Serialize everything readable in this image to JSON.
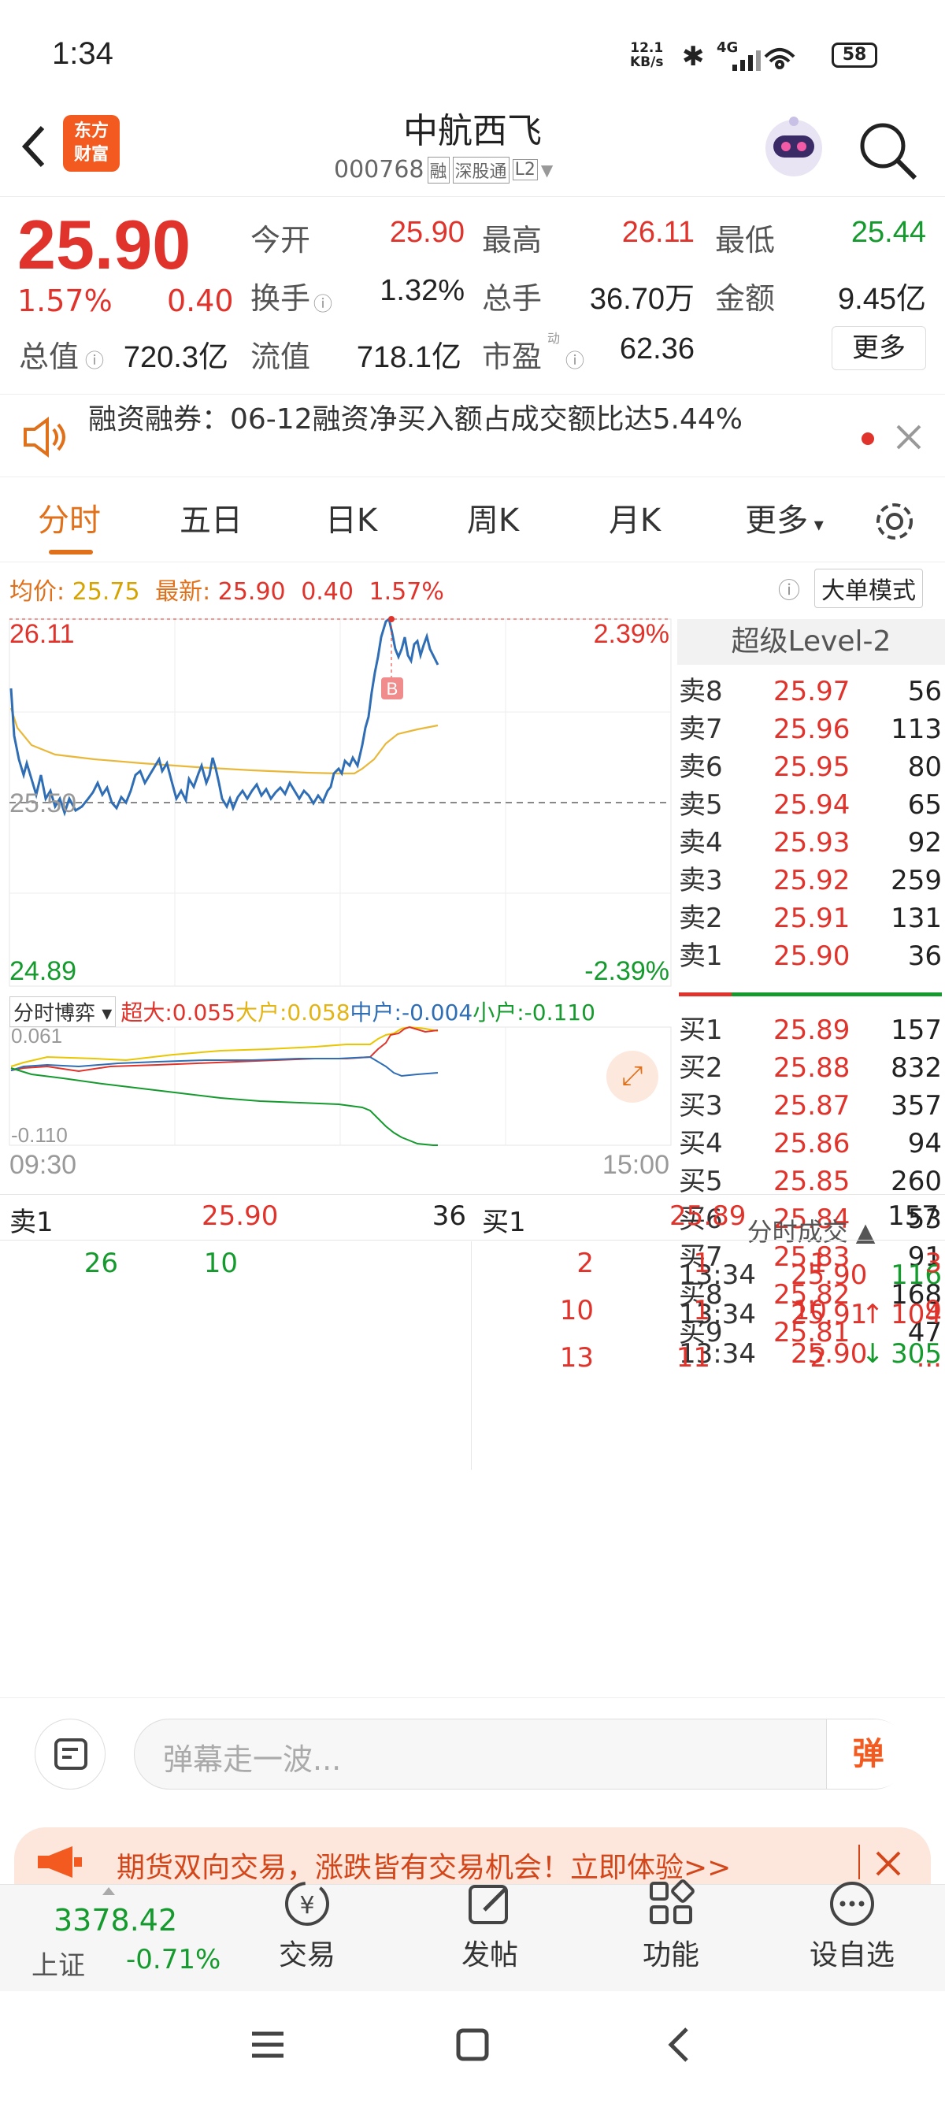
{
  "status": {
    "time": "1:34",
    "speed_num": "12.1",
    "speed_unit": "KB/s",
    "net": "4G",
    "battery": "58"
  },
  "header": {
    "logo_line1": "东方",
    "logo_line2": "财富",
    "stock_name": "中航西飞",
    "code": "000768",
    "tag_rong": "融",
    "tag_sgt": "深股通",
    "tag_l2": "L2"
  },
  "quote": {
    "price": "25.90",
    "change_pct": "1.57%",
    "change_amt": "0.40",
    "fields": [
      {
        "label": "今开",
        "value": "25.90",
        "color": "red"
      },
      {
        "label": "最高",
        "value": "26.11",
        "color": "red"
      },
      {
        "label": "最低",
        "value": "25.44",
        "color": "green"
      },
      {
        "label": "换手",
        "value": "1.32%",
        "color": "black"
      },
      {
        "label": "总手",
        "value": "36.70万",
        "color": "black"
      },
      {
        "label": "金额",
        "value": "9.45亿",
        "color": "black"
      },
      {
        "label": "总值",
        "value": "720.3亿",
        "color": "black"
      },
      {
        "label": "流值",
        "value": "718.1亿",
        "color": "black"
      },
      {
        "label": "市盈",
        "value": "62.36",
        "color": "black"
      }
    ],
    "more": "更多",
    "dyn": "动"
  },
  "news": {
    "text": "融资融券：06-12融资净买入额占成交额比达5.44%"
  },
  "tabs": [
    "分时",
    "五日",
    "日K",
    "周K",
    "月K",
    "更多"
  ],
  "info": {
    "avg_label": "均价:",
    "avg": "25.75",
    "last_label": "最新:",
    "last": "25.90",
    "chg": "0.40",
    "pct": "1.57%",
    "mode": "大单模式"
  },
  "chart_labels": {
    "high": "26.11",
    "high_pct": "2.39%",
    "mid": "25.50",
    "low": "24.89",
    "low_pct": "-2.39%",
    "marker": "B",
    "t_start": "09:30",
    "t_end": "15:00"
  },
  "flow": {
    "selector": "分时博弈",
    "items": [
      {
        "label": "超大:0.055",
        "color": "#e0332b"
      },
      {
        "label": "大户:0.058",
        "color": "#e3b415"
      },
      {
        "label": "中户:-0.004",
        "color": "#2f6db5"
      },
      {
        "label": "小户:-0.110",
        "color": "#159a2e"
      }
    ],
    "ymax": "0.061",
    "ymin": "-0.110"
  },
  "level2": {
    "title": "超级Level-2",
    "sells": [
      {
        "l": "卖8",
        "p": "25.97",
        "v": "56"
      },
      {
        "l": "卖7",
        "p": "25.96",
        "v": "113"
      },
      {
        "l": "卖6",
        "p": "25.95",
        "v": "80"
      },
      {
        "l": "卖5",
        "p": "25.94",
        "v": "65"
      },
      {
        "l": "卖4",
        "p": "25.93",
        "v": "92"
      },
      {
        "l": "卖3",
        "p": "25.92",
        "v": "259"
      },
      {
        "l": "卖2",
        "p": "25.91",
        "v": "131"
      },
      {
        "l": "卖1",
        "p": "25.90",
        "v": "36"
      }
    ],
    "buys": [
      {
        "l": "买1",
        "p": "25.89",
        "v": "157"
      },
      {
        "l": "买2",
        "p": "25.88",
        "v": "832"
      },
      {
        "l": "买3",
        "p": "25.87",
        "v": "357"
      },
      {
        "l": "买4",
        "p": "25.86",
        "v": "94"
      },
      {
        "l": "买5",
        "p": "25.85",
        "v": "260"
      },
      {
        "l": "买6",
        "p": "25.84",
        "v": "53"
      },
      {
        "l": "买7",
        "p": "25.83",
        "v": "91"
      },
      {
        "l": "买8",
        "p": "25.82",
        "v": "168"
      },
      {
        "l": "买9",
        "p": "25.81",
        "v": "47"
      }
    ],
    "trades_title": "分时成交",
    "trades": [
      {
        "t": "13:34",
        "p": "25.90",
        "v": "116",
        "a": ""
      },
      {
        "t": "13:34",
        "p": "25.91",
        "v": "104",
        "a": "↑"
      },
      {
        "t": "13:34",
        "p": "25.90",
        "v": "305",
        "a": "↓"
      }
    ]
  },
  "queue": {
    "sell_label": "卖1",
    "sell_price": "25.90",
    "sell_vol": "36",
    "buy_label": "买1",
    "buy_price": "25.89",
    "buy_vol": "157",
    "sell_orders": [
      "26",
      "10"
    ],
    "buy_rows": [
      [
        "2",
        "1",
        "1",
        "3"
      ],
      [
        "10",
        "1",
        "10",
        "9"
      ],
      [
        "13",
        "11",
        "2",
        "..."
      ]
    ]
  },
  "comment": {
    "placeholder": "弹幕走一波...",
    "dan": "弹"
  },
  "ad": {
    "text": "期货双向交易，涨跌皆有交易机会！立即体验>>"
  },
  "bottom": {
    "index_value": "3378.42",
    "index_name": "上证",
    "index_pct": "-0.71%",
    "items": [
      "交易",
      "发帖",
      "功能",
      "设自选"
    ]
  }
}
